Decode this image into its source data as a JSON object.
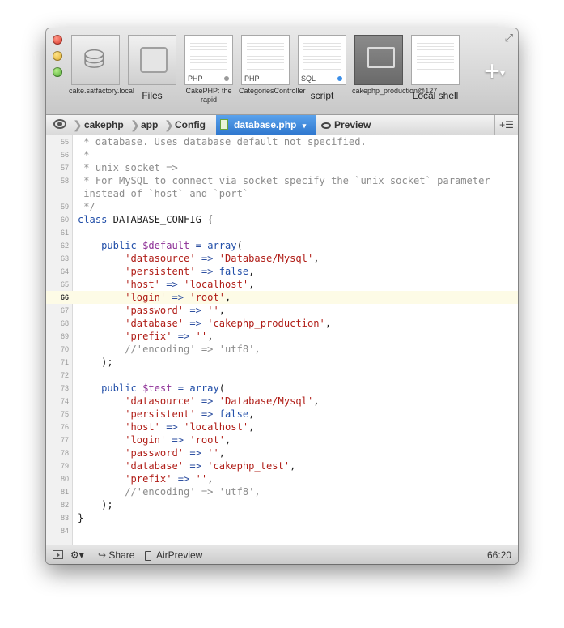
{
  "tabs": [
    {
      "caption": "cake.satfactory.local",
      "tag": "",
      "kind": "db"
    },
    {
      "caption": "Files",
      "tag": "",
      "kind": "files"
    },
    {
      "caption": "CakePHP: the rapid",
      "tag": "PHP",
      "kind": "doc"
    },
    {
      "caption": "CategoriesController",
      "tag": "PHP",
      "kind": "doc"
    },
    {
      "caption": "script",
      "tag": "SQL",
      "kind": "doc"
    },
    {
      "caption": "cakephp_production@127",
      "tag": "",
      "kind": "terminal"
    },
    {
      "caption": "Local shell",
      "tag": "",
      "kind": "shell"
    }
  ],
  "toolbar": {
    "add_label": "+",
    "add_arrow": "▾",
    "fullscreen_glyph": "⤢"
  },
  "path": {
    "segments": [
      "cakephp",
      "app",
      "Config"
    ],
    "file": "database.php",
    "file_arrow": "▾",
    "preview": "Preview",
    "split": "+☰"
  },
  "editor": {
    "current_line": 66,
    "lines": [
      {
        "n": 55,
        "tokens": [
          {
            "t": " * database. Uses database default not specified.",
            "c": "comment"
          }
        ]
      },
      {
        "n": 56,
        "tokens": [
          {
            "t": " *",
            "c": "comment"
          }
        ]
      },
      {
        "n": 57,
        "tokens": [
          {
            "t": " * unix_socket =>",
            "c": "comment"
          }
        ]
      },
      {
        "n": 58,
        "tokens": [
          {
            "t": " * For MySQL to connect via socket specify the `unix_socket` parameter",
            "c": "comment"
          }
        ]
      },
      {
        "n": "",
        "tokens": [
          {
            "t": " instead of `host` and `port`",
            "c": "comment"
          }
        ]
      },
      {
        "n": 59,
        "tokens": [
          {
            "t": " */",
            "c": "comment"
          }
        ]
      },
      {
        "n": 60,
        "tokens": [
          {
            "t": "class",
            "c": "kw"
          },
          {
            "t": " DATABASE_CONFIG {",
            "c": "plain"
          }
        ]
      },
      {
        "n": 61,
        "tokens": []
      },
      {
        "n": 62,
        "tokens": [
          {
            "t": "    public ",
            "c": "kw"
          },
          {
            "t": "$default",
            "c": "var"
          },
          {
            "t": " = ",
            "c": "op"
          },
          {
            "t": "array",
            "c": "fn"
          },
          {
            "t": "(",
            "c": "plain"
          }
        ]
      },
      {
        "n": 63,
        "tokens": [
          {
            "t": "        'datasource'",
            "c": "str"
          },
          {
            "t": " => ",
            "c": "op"
          },
          {
            "t": "'Database/Mysql'",
            "c": "str"
          },
          {
            "t": ",",
            "c": "plain"
          }
        ]
      },
      {
        "n": 64,
        "tokens": [
          {
            "t": "        'persistent'",
            "c": "str"
          },
          {
            "t": " => ",
            "c": "op"
          },
          {
            "t": "false",
            "c": "kw"
          },
          {
            "t": ",",
            "c": "plain"
          }
        ]
      },
      {
        "n": 65,
        "tokens": [
          {
            "t": "        'host'",
            "c": "str"
          },
          {
            "t": " => ",
            "c": "op"
          },
          {
            "t": "'localhost'",
            "c": "str"
          },
          {
            "t": ",",
            "c": "plain"
          }
        ]
      },
      {
        "n": 66,
        "tokens": [
          {
            "t": "        'login'",
            "c": "str"
          },
          {
            "t": " => ",
            "c": "op"
          },
          {
            "t": "'root'",
            "c": "str"
          },
          {
            "t": ",",
            "c": "plain"
          }
        ],
        "caret": true
      },
      {
        "n": 67,
        "tokens": [
          {
            "t": "        'password'",
            "c": "str"
          },
          {
            "t": " => ",
            "c": "op"
          },
          {
            "t": "''",
            "c": "str"
          },
          {
            "t": ",",
            "c": "plain"
          }
        ]
      },
      {
        "n": 68,
        "tokens": [
          {
            "t": "        'database'",
            "c": "str"
          },
          {
            "t": " => ",
            "c": "op"
          },
          {
            "t": "'cakephp_production'",
            "c": "str"
          },
          {
            "t": ",",
            "c": "plain"
          }
        ]
      },
      {
        "n": 69,
        "tokens": [
          {
            "t": "        'prefix'",
            "c": "str"
          },
          {
            "t": " => ",
            "c": "op"
          },
          {
            "t": "''",
            "c": "str"
          },
          {
            "t": ",",
            "c": "plain"
          }
        ]
      },
      {
        "n": 70,
        "tokens": [
          {
            "t": "        //'encoding' => 'utf8',",
            "c": "comment"
          }
        ]
      },
      {
        "n": 71,
        "tokens": [
          {
            "t": "    );",
            "c": "plain"
          }
        ]
      },
      {
        "n": 72,
        "tokens": []
      },
      {
        "n": 73,
        "tokens": [
          {
            "t": "    public ",
            "c": "kw"
          },
          {
            "t": "$test",
            "c": "var"
          },
          {
            "t": " = ",
            "c": "op"
          },
          {
            "t": "array",
            "c": "fn"
          },
          {
            "t": "(",
            "c": "plain"
          }
        ]
      },
      {
        "n": 74,
        "tokens": [
          {
            "t": "        'datasource'",
            "c": "str"
          },
          {
            "t": " => ",
            "c": "op"
          },
          {
            "t": "'Database/Mysql'",
            "c": "str"
          },
          {
            "t": ",",
            "c": "plain"
          }
        ]
      },
      {
        "n": 75,
        "tokens": [
          {
            "t": "        'persistent'",
            "c": "str"
          },
          {
            "t": " => ",
            "c": "op"
          },
          {
            "t": "false",
            "c": "kw"
          },
          {
            "t": ",",
            "c": "plain"
          }
        ]
      },
      {
        "n": 76,
        "tokens": [
          {
            "t": "        'host'",
            "c": "str"
          },
          {
            "t": " => ",
            "c": "op"
          },
          {
            "t": "'localhost'",
            "c": "str"
          },
          {
            "t": ",",
            "c": "plain"
          }
        ]
      },
      {
        "n": 77,
        "tokens": [
          {
            "t": "        'login'",
            "c": "str"
          },
          {
            "t": " => ",
            "c": "op"
          },
          {
            "t": "'root'",
            "c": "str"
          },
          {
            "t": ",",
            "c": "plain"
          }
        ]
      },
      {
        "n": 78,
        "tokens": [
          {
            "t": "        'password'",
            "c": "str"
          },
          {
            "t": " => ",
            "c": "op"
          },
          {
            "t": "''",
            "c": "str"
          },
          {
            "t": ",",
            "c": "plain"
          }
        ]
      },
      {
        "n": 79,
        "tokens": [
          {
            "t": "        'database'",
            "c": "str"
          },
          {
            "t": " => ",
            "c": "op"
          },
          {
            "t": "'cakephp_test'",
            "c": "str"
          },
          {
            "t": ",",
            "c": "plain"
          }
        ]
      },
      {
        "n": 80,
        "tokens": [
          {
            "t": "        'prefix'",
            "c": "str"
          },
          {
            "t": " => ",
            "c": "op"
          },
          {
            "t": "''",
            "c": "str"
          },
          {
            "t": ",",
            "c": "plain"
          }
        ]
      },
      {
        "n": 81,
        "tokens": [
          {
            "t": "        //'encoding' => 'utf8',",
            "c": "comment"
          }
        ]
      },
      {
        "n": 82,
        "tokens": [
          {
            "t": "    );",
            "c": "plain"
          }
        ]
      },
      {
        "n": 83,
        "tokens": [
          {
            "t": "}",
            "c": "plain"
          }
        ]
      },
      {
        "n": 84,
        "tokens": []
      }
    ]
  },
  "status": {
    "gear_glyph": "⚙▾",
    "share": "Share",
    "airpreview": "AirPreview",
    "position": "66:20"
  }
}
